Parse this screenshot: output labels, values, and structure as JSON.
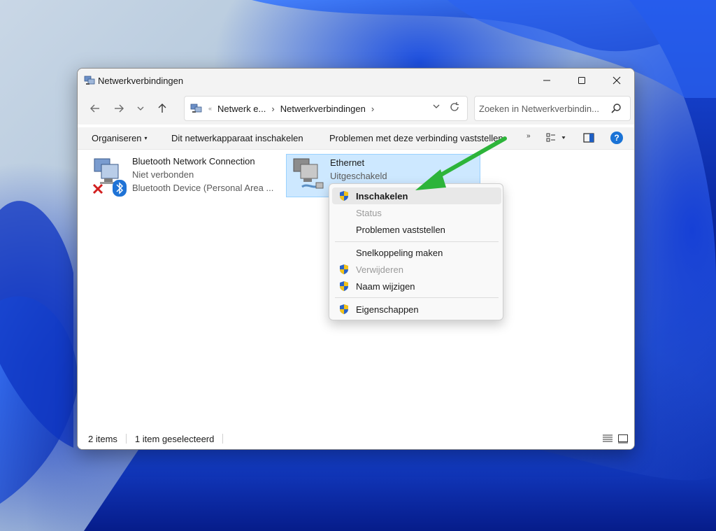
{
  "window": {
    "title": "Netwerkverbindingen"
  },
  "navigation": {
    "back_icon": "arrow-left-icon",
    "forward_icon": "arrow-right-icon",
    "recent_icon": "chevron-down-icon",
    "up_icon": "arrow-up-icon"
  },
  "address": {
    "overflow": "«",
    "crumb1": "Netwerk e...",
    "crumb2": "Netwerkverbindingen",
    "separator": "›"
  },
  "search": {
    "placeholder": "Zoeken in Netwerkverbindin..."
  },
  "commandbar": {
    "organize": "Organiseren",
    "enable_device": "Dit netwerkapparaat inschakelen",
    "diagnose": "Problemen met deze verbinding vaststellen",
    "more": "»",
    "help": "?"
  },
  "connections": [
    {
      "name": "Bluetooth Network Connection",
      "status": "Niet verbonden",
      "device": "Bluetooth Device (Personal Area ...",
      "selected": false
    },
    {
      "name": "Ethernet",
      "status": "Uitgeschakeld",
      "device": "",
      "selected": true
    }
  ],
  "context_menu": {
    "items": [
      {
        "label": "Inschakelen",
        "shield": true,
        "disabled": false,
        "default": true
      },
      {
        "label": "Status",
        "shield": false,
        "disabled": true,
        "default": false
      },
      {
        "label": "Problemen vaststellen",
        "shield": false,
        "disabled": false,
        "default": false
      },
      {
        "label": "Snelkoppeling maken",
        "shield": false,
        "disabled": false,
        "default": false
      },
      {
        "label": "Verwijderen",
        "shield": true,
        "disabled": true,
        "default": false
      },
      {
        "label": "Naam wijzigen",
        "shield": true,
        "disabled": false,
        "default": false
      },
      {
        "label": "Eigenschappen",
        "shield": true,
        "disabled": false,
        "default": false
      }
    ]
  },
  "statusbar": {
    "count": "2 items",
    "selection": "1 item geselecteerd"
  },
  "colors": {
    "annotation_arrow": "#2db43a",
    "selection_bg": "#cde8ff",
    "accent": "#1a73d6"
  }
}
